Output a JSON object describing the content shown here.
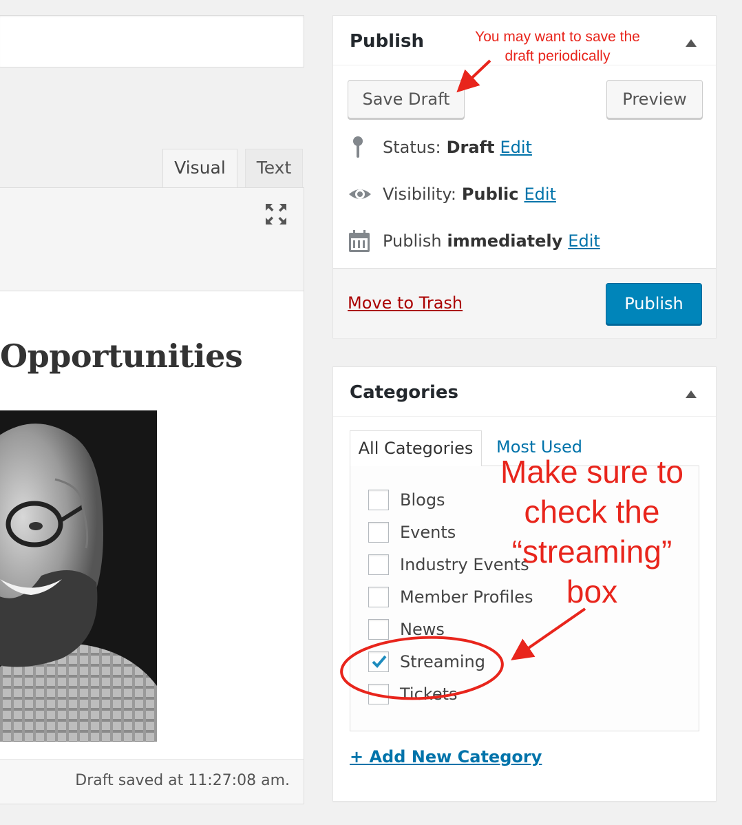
{
  "editor": {
    "tabs": [
      "Visual",
      "Text"
    ],
    "post_heading": "Opportunities",
    "status_text": "Draft saved at 11:27:08 am."
  },
  "publish_box": {
    "title": "Publish",
    "save_draft_label": "Save Draft",
    "preview_label": "Preview",
    "status_label": "Status:",
    "status_value": "Draft",
    "visibility_label": "Visibility:",
    "visibility_value": "Public",
    "schedule_label": "Publish",
    "schedule_value": "immediately",
    "edit_link": "Edit",
    "trash_label": "Move to Trash",
    "publish_label": "Publish"
  },
  "categories_box": {
    "title": "Categories",
    "tabs": [
      "All Categories",
      "Most Used"
    ],
    "items": [
      {
        "label": "Blogs",
        "checked": false
      },
      {
        "label": "Events",
        "checked": false
      },
      {
        "label": "Industry Events",
        "checked": false
      },
      {
        "label": "Member Profiles",
        "checked": false
      },
      {
        "label": "News",
        "checked": false
      },
      {
        "label": "Streaming",
        "checked": true
      },
      {
        "label": "Tickets",
        "checked": false
      }
    ],
    "add_new_label": "+ Add New Category"
  },
  "annotations": {
    "save_note_line1": "You may want to save the",
    "save_note_line2": "draft periodically",
    "streaming_note_line1": "Make sure to",
    "streaming_note_line2": "check the",
    "streaming_note_line3": "“streaming”",
    "streaming_note_line4": "box",
    "color": "#e8251c"
  },
  "colors": {
    "primary_button": "#0085ba",
    "link": "#0073aa",
    "trash": "#aa0000"
  }
}
